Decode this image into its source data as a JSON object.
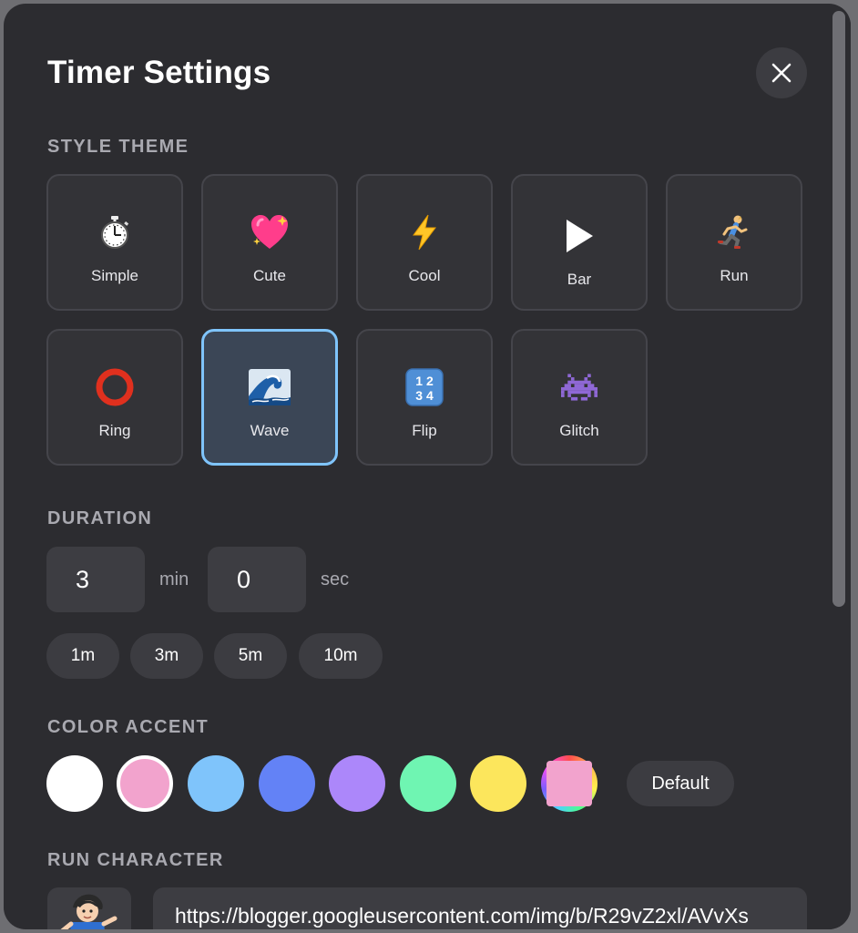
{
  "dialog": {
    "title": "Timer Settings",
    "close_label": "close"
  },
  "sections": {
    "style_theme": "STYLE THEME",
    "duration": "DURATION",
    "color_accent": "COLOR ACCENT",
    "run_character": "RUN CHARACTER"
  },
  "themes": [
    {
      "label": "Simple",
      "icon": "stopwatch-icon",
      "selected": false
    },
    {
      "label": "Cute",
      "icon": "sparkling-heart-icon",
      "selected": false
    },
    {
      "label": "Cool",
      "icon": "lightning-icon",
      "selected": false
    },
    {
      "label": "Bar",
      "icon": "play-triangle-icon",
      "selected": false
    },
    {
      "label": "Run",
      "icon": "runner-icon",
      "selected": false
    },
    {
      "label": "Ring",
      "icon": "red-ring-icon",
      "selected": false
    },
    {
      "label": "Wave",
      "icon": "wave-icon",
      "selected": true
    },
    {
      "label": "Flip",
      "icon": "numbers-1234-icon",
      "selected": false
    },
    {
      "label": "Glitch",
      "icon": "space-invader-icon",
      "selected": false
    }
  ],
  "duration": {
    "minutes": "3",
    "min_unit": "min",
    "seconds": "0",
    "sec_unit": "sec",
    "presets": [
      "1m",
      "3m",
      "5m",
      "10m"
    ]
  },
  "colors": {
    "swatches": [
      "#ffffff",
      "#f2a3cd",
      "#7fc4fb",
      "#6382f6",
      "#ac87fa",
      "#6ff5b2",
      "#fce65c",
      "rainbow"
    ],
    "selected_index": 1,
    "default_label": "Default",
    "accent_selected": "#7fc4fb"
  },
  "run_character": {
    "avatar_icon": "runner-character-icon",
    "url": "https://blogger.googleusercontent.com/img/b/R29vZ2xl/AVvXs"
  }
}
